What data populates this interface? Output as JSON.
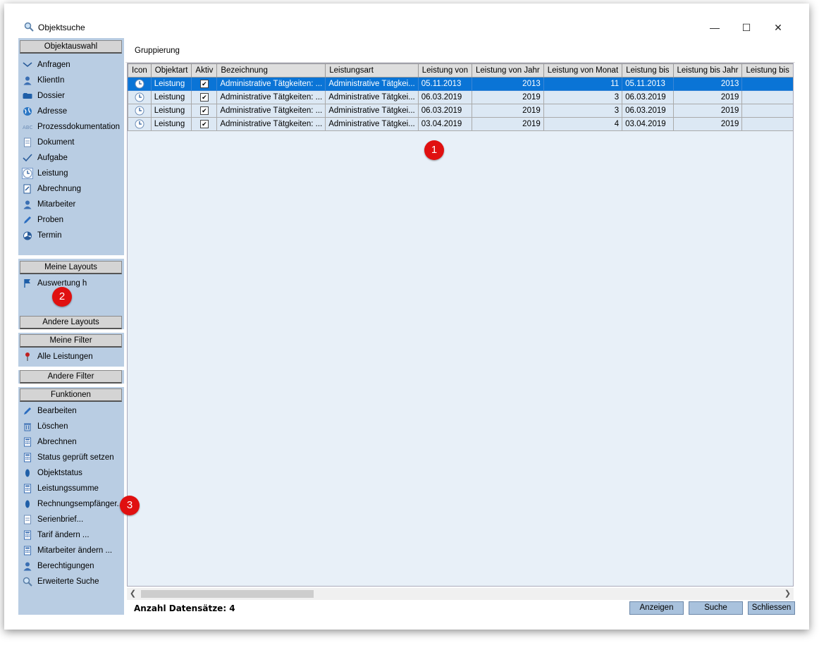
{
  "window": {
    "title": "Objektsuche"
  },
  "sidebar": {
    "objektauswahl_header": "Objektauswahl",
    "objekt_items": [
      {
        "label": "Anfragen",
        "icon": "envelope-icon"
      },
      {
        "label": "KlientIn",
        "icon": "person-icon"
      },
      {
        "label": "Dossier",
        "icon": "folder-icon"
      },
      {
        "label": "Adresse",
        "icon": "globe-icon"
      },
      {
        "label": "Prozessdokumentation",
        "icon": "abc-icon"
      },
      {
        "label": "Dokument",
        "icon": "document-icon"
      },
      {
        "label": "Aufgabe",
        "icon": "checkmark-icon"
      },
      {
        "label": "Leistung",
        "icon": "clock-icon"
      },
      {
        "label": "Abrechnung",
        "icon": "invoice-icon"
      },
      {
        "label": "Mitarbeiter",
        "icon": "person-icon"
      },
      {
        "label": "Proben",
        "icon": "pen-icon"
      },
      {
        "label": "Termin",
        "icon": "calendar-icon"
      }
    ],
    "meine_layouts_header": "Meine Layouts",
    "meine_layouts_items": [
      {
        "label": "Auswertung h",
        "icon": "flag-icon"
      }
    ],
    "andere_layouts_header": "Andere Layouts",
    "meine_filter_header": "Meine Filter",
    "meine_filter_items": [
      {
        "label": "Alle Leistungen",
        "icon": "pin-icon"
      }
    ],
    "andere_filter_header": "Andere Filter",
    "funktionen_header": "Funktionen",
    "funktionen_items": [
      {
        "label": "Bearbeiten",
        "icon": "pen-icon"
      },
      {
        "label": "Löschen",
        "icon": "trash-icon"
      },
      {
        "label": "Abrechnen",
        "icon": "calculator-icon"
      },
      {
        "label": "Status geprüft setzen",
        "icon": "calculator-icon"
      },
      {
        "label": "Objektstatus",
        "icon": "status-icon"
      },
      {
        "label": "Leistungssumme",
        "icon": "calculator-icon"
      },
      {
        "label": "Rechnungsempfänger...",
        "icon": "status-icon"
      },
      {
        "label": "Serienbrief...",
        "icon": "document-icon"
      },
      {
        "label": "Tarif ändern ...",
        "icon": "calculator-icon"
      },
      {
        "label": "Mitarbeiter ändern ...",
        "icon": "calculator-icon"
      },
      {
        "label": "Berechtigungen",
        "icon": "person-icon"
      },
      {
        "label": "Erweiterte Suche",
        "icon": "search-icon"
      }
    ]
  },
  "main": {
    "grouping_label": "Gruppierung",
    "columns": [
      "Icon",
      "Objektart",
      "Aktiv",
      "Bezeichnung",
      "Leistungsart",
      "Leistung von",
      "Leistung von Jahr",
      "Leistung von Monat",
      "Leistung bis",
      "Leistung bis Jahr",
      "Leistung bis"
    ],
    "rows": [
      {
        "objektart": "Leistung",
        "aktiv": "✔",
        "bezeichnung": "Administrative Tätgkeiten: ...",
        "leistungsart": "Administrative Tätgkei...",
        "von": "05.11.2013",
        "von_jahr": "2013",
        "von_monat": "11",
        "bis": "05.11.2013",
        "bis_jahr": "2013"
      },
      {
        "objektart": "Leistung",
        "aktiv": "✔",
        "bezeichnung": "Administrative Tätgkeiten: ...",
        "leistungsart": "Administrative Tätgkei...",
        "von": "06.03.2019",
        "von_jahr": "2019",
        "von_monat": "3",
        "bis": "06.03.2019",
        "bis_jahr": "2019"
      },
      {
        "objektart": "Leistung",
        "aktiv": "✔",
        "bezeichnung": "Administrative Tätgkeiten: ...",
        "leistungsart": "Administrative Tätgkei...",
        "von": "06.03.2019",
        "von_jahr": "2019",
        "von_monat": "3",
        "bis": "06.03.2019",
        "bis_jahr": "2019"
      },
      {
        "objektart": "Leistung",
        "aktiv": "✔",
        "bezeichnung": "Administrative Tätgkeiten: ...",
        "leistungsart": "Administrative Tätgkei...",
        "von": "03.04.2019",
        "von_jahr": "2019",
        "von_monat": "4",
        "bis": "03.04.2019",
        "bis_jahr": "2019"
      }
    ],
    "count_label": "Anzahl Datensätze: 4",
    "buttons": {
      "anzeigen": "Anzeigen",
      "suche": "Suche",
      "schliessen": "Schliessen"
    }
  },
  "badges": [
    "1",
    "2",
    "3"
  ],
  "colors": {
    "sidebar_bg": "#b9cde3",
    "selection": "#0a74d6",
    "badge": "#e01010"
  }
}
